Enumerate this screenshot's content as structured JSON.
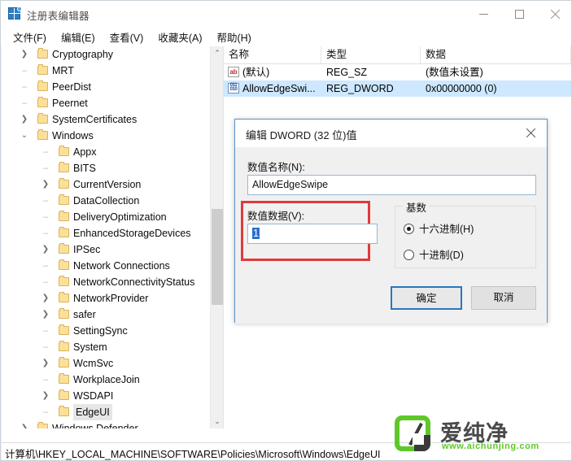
{
  "window": {
    "title": "注册表编辑器",
    "icon": "registry-editor-icon",
    "minimize_label": "—",
    "maximize_label": "□",
    "close_label": "✕"
  },
  "menubar": {
    "items": [
      {
        "label": "文件(F)"
      },
      {
        "label": "编辑(E)"
      },
      {
        "label": "查看(V)"
      },
      {
        "label": "收藏夹(A)"
      },
      {
        "label": "帮助(H)"
      }
    ]
  },
  "tree": {
    "scroll_up_label": "⌃",
    "scroll_down_label": "⌄",
    "scroll_left_label": "‹",
    "scroll_right_label": "›",
    "items": [
      {
        "label": "Cryptography",
        "depth": 1,
        "expander": "collapsed"
      },
      {
        "label": "MRT",
        "depth": 1,
        "expander": "none"
      },
      {
        "label": "PeerDist",
        "depth": 1,
        "expander": "none"
      },
      {
        "label": "Peernet",
        "depth": 1,
        "expander": "none"
      },
      {
        "label": "SystemCertificates",
        "depth": 1,
        "expander": "collapsed"
      },
      {
        "label": "Windows",
        "depth": 1,
        "expander": "expanded"
      },
      {
        "label": "Appx",
        "depth": 2,
        "expander": "none"
      },
      {
        "label": "BITS",
        "depth": 2,
        "expander": "none"
      },
      {
        "label": "CurrentVersion",
        "depth": 2,
        "expander": "collapsed"
      },
      {
        "label": "DataCollection",
        "depth": 2,
        "expander": "none"
      },
      {
        "label": "DeliveryOptimization",
        "depth": 2,
        "expander": "none"
      },
      {
        "label": "EnhancedStorageDevices",
        "depth": 2,
        "expander": "none"
      },
      {
        "label": "IPSec",
        "depth": 2,
        "expander": "collapsed"
      },
      {
        "label": "Network Connections",
        "depth": 2,
        "expander": "none"
      },
      {
        "label": "NetworkConnectivityStatus",
        "depth": 2,
        "expander": "none"
      },
      {
        "label": "NetworkProvider",
        "depth": 2,
        "expander": "collapsed"
      },
      {
        "label": "safer",
        "depth": 2,
        "expander": "collapsed"
      },
      {
        "label": "SettingSync",
        "depth": 2,
        "expander": "none"
      },
      {
        "label": "System",
        "depth": 2,
        "expander": "none"
      },
      {
        "label": "WcmSvc",
        "depth": 2,
        "expander": "collapsed"
      },
      {
        "label": "WorkplaceJoin",
        "depth": 2,
        "expander": "none"
      },
      {
        "label": "WSDAPI",
        "depth": 2,
        "expander": "collapsed"
      },
      {
        "label": "EdgeUI",
        "depth": 2,
        "expander": "none",
        "selected": true
      },
      {
        "label": "Windows Defender",
        "depth": 1,
        "expander": "collapsed"
      }
    ]
  },
  "list": {
    "columns": [
      {
        "label": "名称"
      },
      {
        "label": "类型"
      },
      {
        "label": "数据"
      }
    ],
    "rows": [
      {
        "icon": "string-value-icon",
        "icon_text": "ab",
        "name": "(默认)",
        "type": "REG_SZ",
        "data": "(数值未设置)",
        "selected": false
      },
      {
        "icon": "dword-value-icon",
        "icon_text": "011\n010",
        "name": "AllowEdgeSwi...",
        "type": "REG_DWORD",
        "data": "0x00000000 (0)",
        "selected": true
      }
    ]
  },
  "dialog": {
    "title": "编辑 DWORD (32 位)值",
    "close_label": "✕",
    "name_label": "数值名称(N):",
    "name_value": "AllowEdgeSwipe",
    "data_label": "数值数据(V):",
    "data_value": "1",
    "base_group_label": "基数",
    "radios": [
      {
        "label": "十六进制(H)",
        "checked": true
      },
      {
        "label": "十进制(D)",
        "checked": false
      }
    ],
    "ok_label": "确定",
    "cancel_label": "取消",
    "highlight_color": "#e03a3a"
  },
  "statusbar": {
    "path": "计算机\\HKEY_LOCAL_MACHINE\\SOFTWARE\\Policies\\Microsoft\\Windows\\EdgeUI"
  },
  "watermark": {
    "brand": "爱纯净",
    "url": "www.aichunjing.com",
    "color": "#5ec82a"
  }
}
